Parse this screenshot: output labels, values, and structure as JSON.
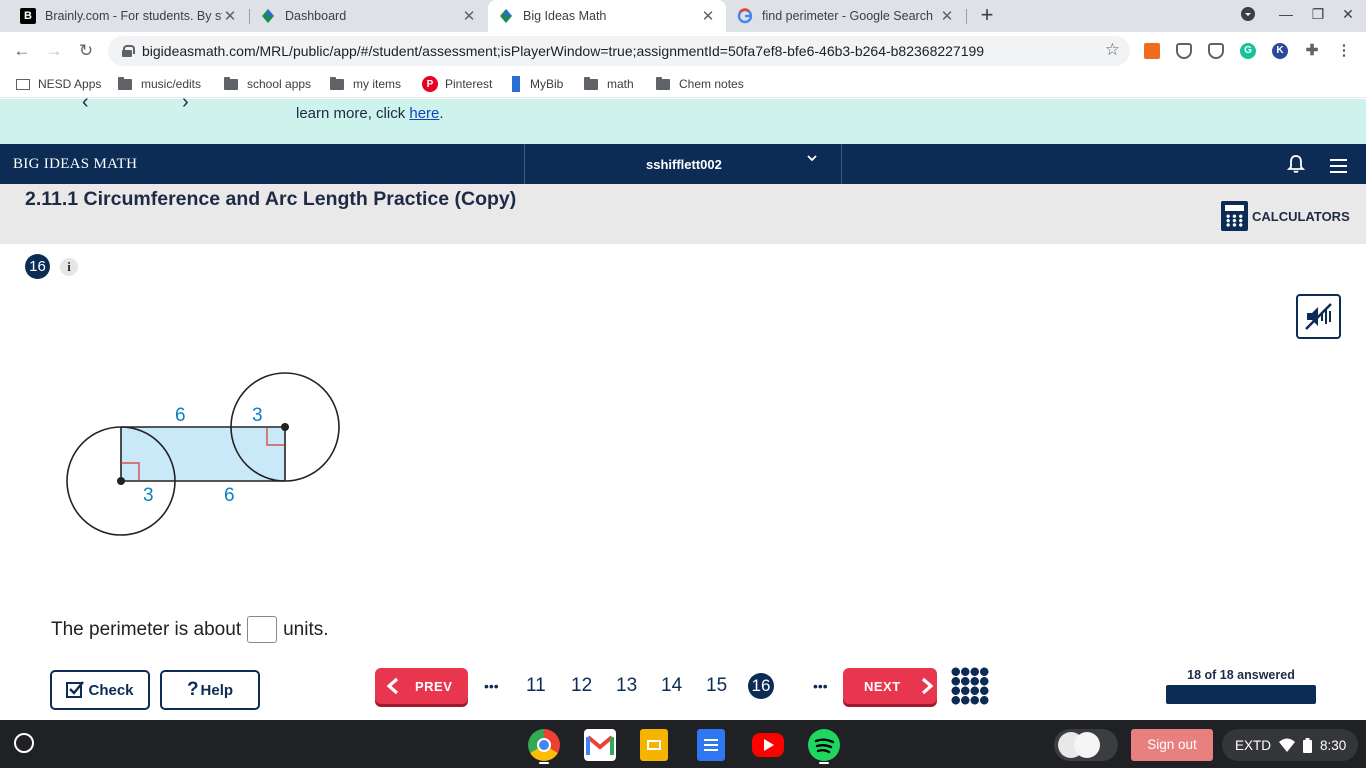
{
  "browser": {
    "tabs": [
      {
        "title": "Brainly.com - For students. By st",
        "favicon": "brainly-icon"
      },
      {
        "title": "Dashboard",
        "favicon": "bim-logo-icon"
      },
      {
        "title": "Big Ideas Math",
        "favicon": "bim-logo-icon",
        "active": true
      },
      {
        "title": "find perimeter - Google Search",
        "favicon": "google-icon"
      }
    ],
    "url": "bigideasmath.com/MRL/public/app/#/student/assessment;isPlayerWindow=true;assignmentId=50fa7ef8-bfe6-46b3-b264-b82368227199",
    "bookmarks": [
      "NESD Apps",
      "music/edits",
      "school apps",
      "my items",
      "Pinterest",
      "MyBib",
      "math",
      "Chem notes"
    ]
  },
  "banner": {
    "text": "learn more, click ",
    "link": "here",
    "suffix": "."
  },
  "header": {
    "brand": "BIG IDEAS MATH",
    "username": "sshifflett002"
  },
  "assignment": {
    "title": "2.11.1 Circumference and Arc Length Practice (Copy)",
    "calculators_label": "CALCULATORS"
  },
  "question": {
    "number": "16",
    "info_label": "i",
    "figure_labels": {
      "top_left": "6",
      "top_right": "3",
      "bottom_left": "3",
      "bottom_right": "6"
    },
    "prompt_before": "The perimeter is about",
    "prompt_after": "units.",
    "answer_value": ""
  },
  "controls": {
    "check_label": "Check",
    "help_label": "Help",
    "prev_label": "PREV",
    "next_label": "NEXT",
    "ellipsis": "•••",
    "pages": [
      "11",
      "12",
      "13",
      "14",
      "15"
    ],
    "current_page": "16",
    "answered_text": "18 of 18 answered",
    "answered_fraction": 1.0
  },
  "shelf": {
    "sign_out": "Sign out",
    "keyboard": "EXTD",
    "time": "8:30"
  },
  "colors": {
    "navy": "#0c2c55",
    "accent_red": "#e8364f",
    "banner": "#cdf3ec",
    "figure_blue": "#0a7fc4",
    "shaded_region": "#c9e8f8"
  }
}
